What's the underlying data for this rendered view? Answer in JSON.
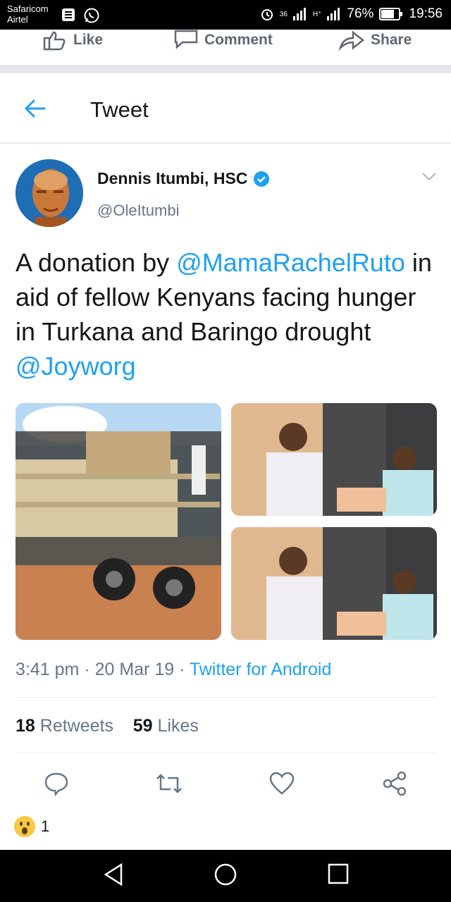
{
  "status_bar": {
    "carrier1": "Safaricom",
    "carrier2": "Airtel",
    "network1": "36",
    "network2": "H⁺",
    "battery": "76%",
    "time": "19:56"
  },
  "fb_actions": {
    "like": "Like",
    "comment": "Comment",
    "share": "Share"
  },
  "header": {
    "title": "Tweet"
  },
  "tweet": {
    "author_name": "Dennis Itumbi, HSC",
    "handle": "@OleItumbi",
    "text_parts": [
      "A donation by ",
      "@MamaRachelRuto",
      " in aid of fellow Kenyans facing hunger in Turkana and Baringo drought ",
      "@Joyworg"
    ],
    "time": "3:41 pm",
    "date": "20 Mar 19",
    "source": "Twitter for Android",
    "sep": " · ",
    "retweets_count": "18",
    "retweets_label": "Retweets",
    "likes_count": "59",
    "likes_label": "Likes",
    "reaction_count": "1"
  },
  "colors": {
    "twitter_blue": "#1da1f2",
    "secondary_text": "#657786",
    "fb_gray": "#606770"
  },
  "icons": {
    "reply": "reply-icon",
    "retweet": "retweet-icon",
    "like": "heart-icon",
    "share": "share-icon"
  }
}
